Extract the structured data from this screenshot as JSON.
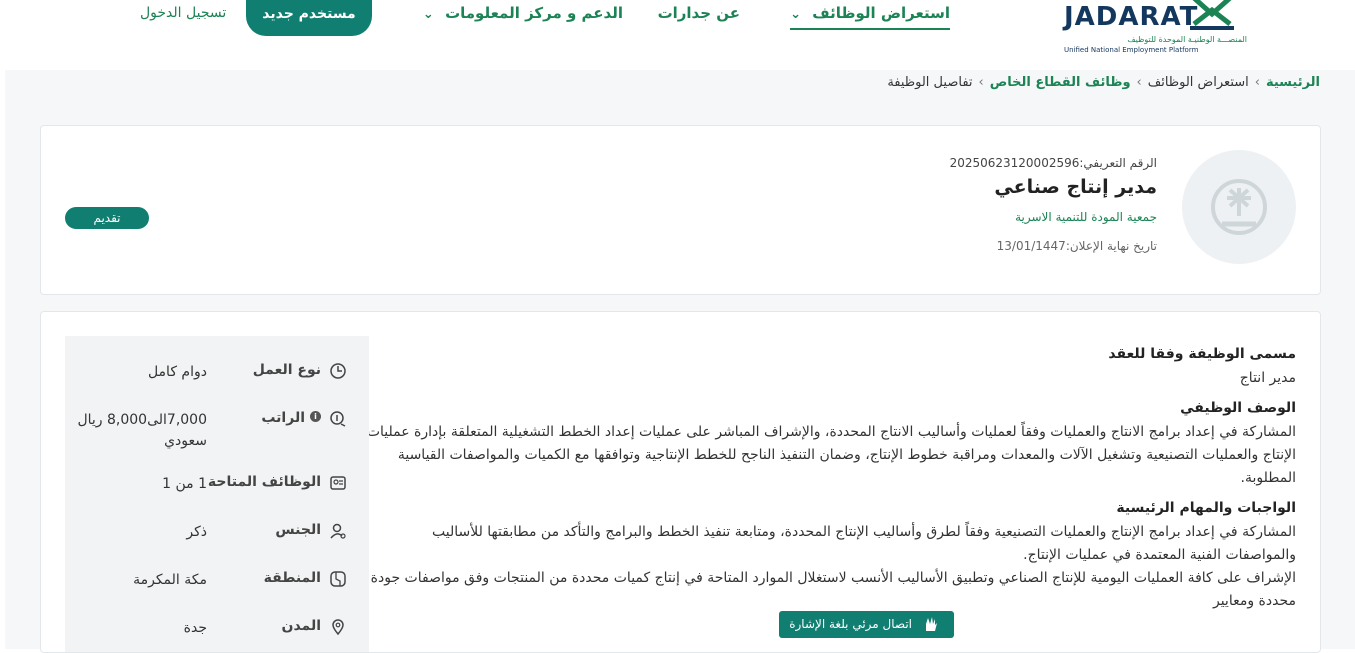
{
  "header": {
    "logo": {
      "wordmark": "JADARAT",
      "subtitle_ar": "المنصـــة الوطنيـة الموحدة للتوظيف",
      "subtitle_en": "Unified National Employment Platform"
    },
    "nav": [
      {
        "label": "استعراض الوظائف",
        "active": true,
        "has_dropdown": true
      },
      {
        "label": "عن جدارات",
        "active": false,
        "has_dropdown": false
      },
      {
        "label": "الدعم و مركز المعلومات",
        "active": false,
        "has_dropdown": true
      }
    ],
    "new_user_label": "مستخدم جديد",
    "login_label": "تسجيل الدخول"
  },
  "breadcrumb": {
    "home": "الرئيسية",
    "browse": "استعراض الوظائف",
    "private_sector": "وظائف القطاع الخاص",
    "current": "تفاصيل الوظيفة"
  },
  "job": {
    "reference": "الرقم التعريفي:20250623120002596",
    "title": "مدير إنتاج صناعي",
    "organization": "جمعية المودة للتنمية الاسرية",
    "deadline": "تاريخ نهاية الإعلان:13/01/1447",
    "apply_label": "تقديم"
  },
  "details": {
    "contract_title_heading": "مسمى الوظيفة وفقا للعقد",
    "contract_title": "مدير انتاج",
    "description_heading": "الوصف الوظيفي",
    "description": "المشاركة في إعداد برامج الانتاج والعمليات وفقاً لعمليات وأساليب الانتاج المحددة، والإشراف المباشر على عمليات إعداد الخطط التشغيلية المتعلقة بإدارة عمليات الإنتاج والعمليات التصنيعية وتشغيل الآلات والمعدات ومراقبة خطوط الإنتاج، وضمان التنفيذ الناجح للخطط الإنتاجية وتوافقها مع الكميات والمواصفات القياسية المطلوبة.",
    "duties_heading": "الواجبات والمهام الرئيسية",
    "duty_1": "المشاركة في إعداد برامج الإنتاج والعمليات التصنيعية وفقاً لطرق وأساليب الإنتاج المحددة، ومتابعة تنفيذ الخطط والبرامج والتأكد من مطابقتها للأساليب والمواصفات الفنية المعتمدة في عمليات الإنتاج.",
    "duty_2": "الإشراف على كافة العمليات اليومية للإنتاج الصناعي وتطبيق الأساليب الأنسب لاستغلال الموارد المتاحة في إنتاج كميات محددة من المنتجات وفق مواصفات جودة محددة ومعايير"
  },
  "attributes": [
    {
      "label": "نوع العمل",
      "value": "دوام كامل",
      "icon": "clock-icon"
    },
    {
      "label": "الراتب",
      "value": "7,000الى8,000 ريال سعودي",
      "icon": "salary-icon",
      "has_info": true
    },
    {
      "label": "الوظائف المتاحة",
      "value": "1 من 1",
      "icon": "id-card-icon"
    },
    {
      "label": "الجنس",
      "value": "ذكر",
      "icon": "gender-icon"
    },
    {
      "label": "المنطقة",
      "value": "مكة المكرمة",
      "icon": "map-icon"
    },
    {
      "label": "المدن",
      "value": "جدة",
      "icon": "location-pin-icon"
    }
  ],
  "sign_language": {
    "label": "اتصال مرئي بلغة الإشارة",
    "icon": "sign-language-hand-icon"
  },
  "colors": {
    "primary": "#117e72",
    "link": "#1b8354",
    "brand_dark": "#14375e"
  }
}
